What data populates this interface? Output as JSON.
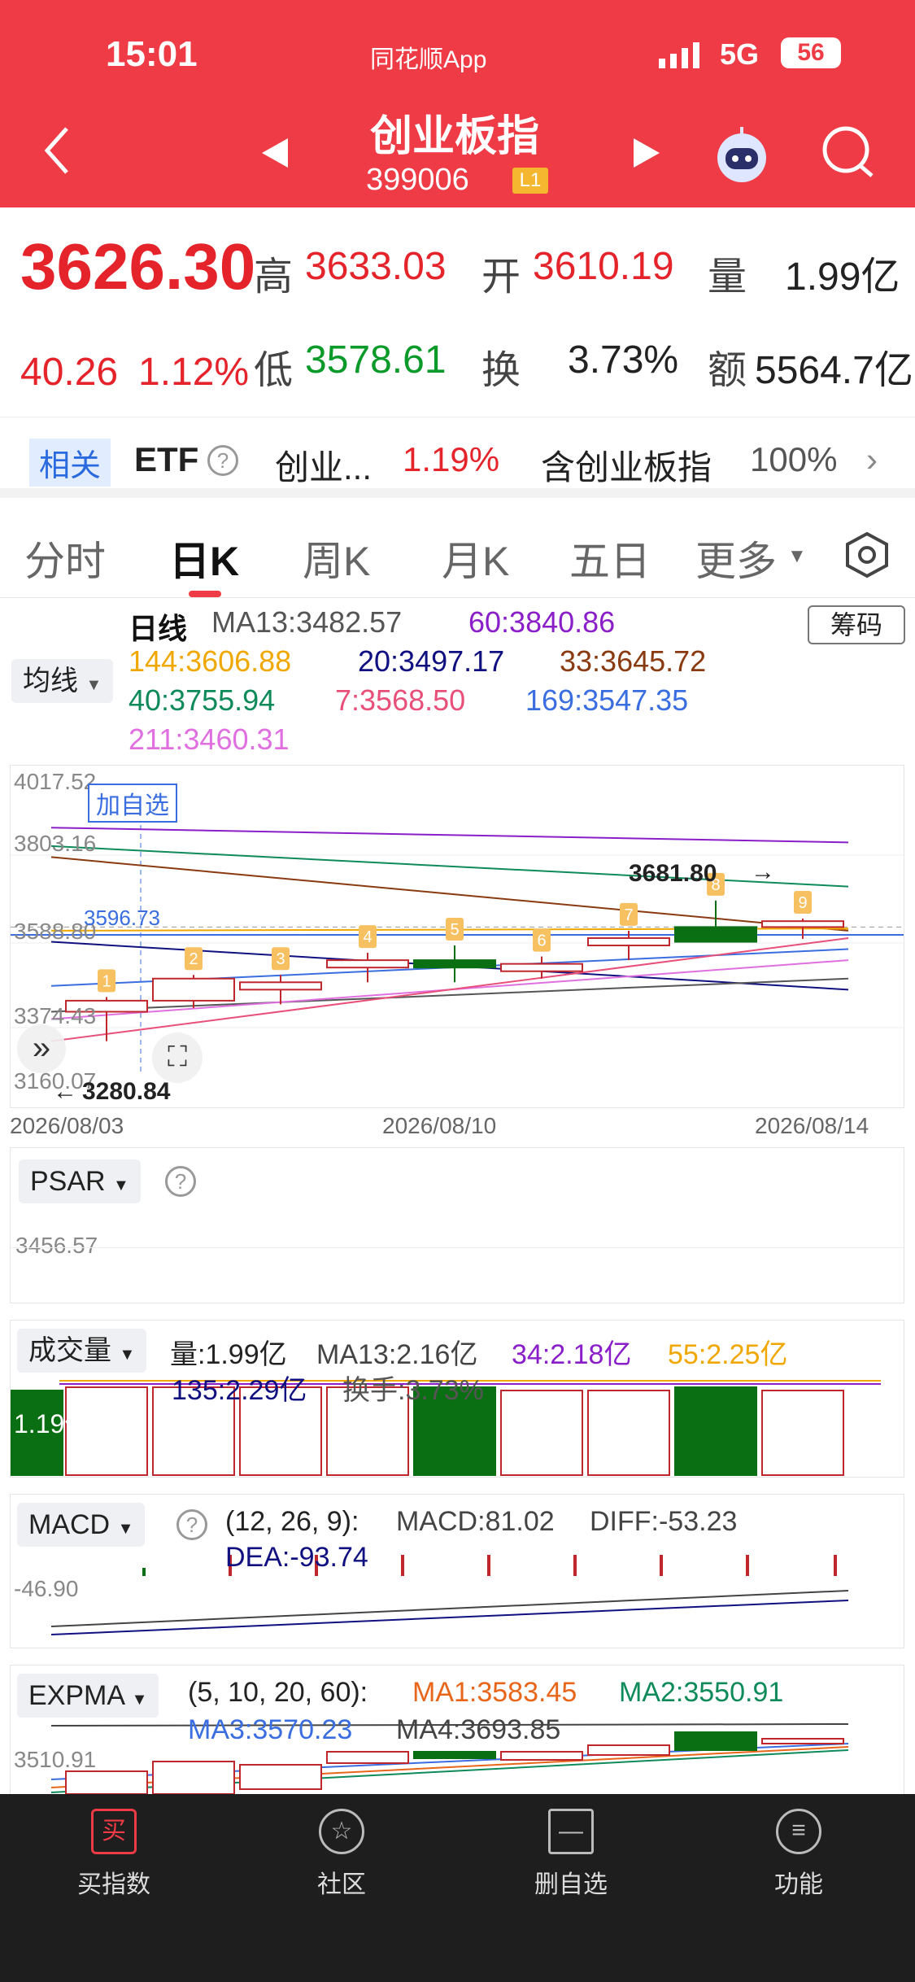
{
  "status_bar": {
    "time": "15:01",
    "app": "同花顺App",
    "network": "5G",
    "battery": "56"
  },
  "header": {
    "title": "创业板指",
    "code": "399006",
    "level": "L1"
  },
  "quote": {
    "price": "3626.30",
    "change": "40.26",
    "change_pct": "1.12%",
    "high_label": "高",
    "high": "3633.03",
    "open_label": "开",
    "open": "3610.19",
    "vol_label": "量",
    "vol": "1.99亿",
    "low_label": "低",
    "low": "3578.61",
    "turn_label": "换",
    "turn": "3.73%",
    "amt_label": "额",
    "amt": "5564.7亿"
  },
  "related": {
    "tag": "相关",
    "etf": "ETF",
    "name": "创业...",
    "pct": "1.19%",
    "contains": "含创业板指",
    "weight": "100%"
  },
  "tabs": [
    "分时",
    "日K",
    "周K",
    "月K",
    "五日",
    "更多"
  ],
  "kline": {
    "mode": "日线",
    "ma_button": "均线",
    "chip_button": "筹码",
    "add_watch": "加自选",
    "mas": [
      {
        "t": "MA13:3482.57",
        "c": "#555555"
      },
      {
        "t": "60:3840.86",
        "c": "#8a1ec8"
      },
      {
        "t": "144:3606.88",
        "c": "#f0a800"
      },
      {
        "t": "20:3497.17",
        "c": "#101080"
      },
      {
        "t": "33:3645.72",
        "c": "#8a3a10"
      },
      {
        "t": "40:3755.94",
        "c": "#0f8a5a"
      },
      {
        "t": "7:3568.50",
        "c": "#e8507a"
      },
      {
        "t": "169:3547.35",
        "c": "#3a6ee0"
      },
      {
        "t": "211:3460.31",
        "c": "#e070e0"
      }
    ],
    "y_ticks": [
      "4017.52",
      "3803.16",
      "3588.80",
      "3374.43",
      "3160.07"
    ],
    "crosshair_price": "3596.73",
    "high_mark": "3681.80",
    "low_mark": "3280.84",
    "dates": [
      "2026/08/03",
      "2026/08/10",
      "2026/08/14"
    ],
    "markers": [
      "1",
      "2",
      "3",
      "4",
      "5",
      "6",
      "7",
      "8",
      "9"
    ]
  },
  "chart_data": {
    "type": "candlestick",
    "candles": [
      {
        "o": 3380,
        "h": 3420,
        "l": 3300,
        "c": 3410,
        "up": true
      },
      {
        "o": 3410,
        "h": 3480,
        "l": 3390,
        "c": 3470,
        "up": true
      },
      {
        "o": 3440,
        "h": 3480,
        "l": 3400,
        "c": 3460,
        "up": true
      },
      {
        "o": 3500,
        "h": 3540,
        "l": 3460,
        "c": 3520,
        "up": true
      },
      {
        "o": 3520,
        "h": 3560,
        "l": 3460,
        "c": 3500,
        "up": false
      },
      {
        "o": 3490,
        "h": 3530,
        "l": 3470,
        "c": 3510,
        "up": true
      },
      {
        "o": 3560,
        "h": 3600,
        "l": 3520,
        "c": 3580,
        "up": true
      },
      {
        "o": 3610,
        "h": 3682,
        "l": 3580,
        "c": 3570,
        "up": false
      },
      {
        "o": 3610,
        "h": 3633,
        "l": 3578,
        "c": 3626,
        "up": true
      }
    ]
  },
  "psar": {
    "label": "PSAR",
    "value": "3456.57"
  },
  "volume": {
    "label": "成交量",
    "vol": "量:1.99亿",
    "ma13": "MA13:2.16亿",
    "ma34": "34:2.18亿",
    "ma55": "55:2.25亿",
    "ma135": "135:2.29亿",
    "turn": "换手:3.73%",
    "axis": "1.19亿"
  },
  "macd": {
    "label": "MACD",
    "params": "(12, 26, 9):",
    "macd": "MACD:81.02",
    "diff": "DIFF:-53.23",
    "dea": "DEA:-93.74",
    "axis": "-46.90"
  },
  "expma": {
    "label": "EXPMA",
    "params": "(5, 10, 20, 60):",
    "ma1": "MA1:3583.45",
    "ma2": "MA2:3550.91",
    "ma3": "MA3:3570.23",
    "ma4": "MA4:3693.85",
    "axis": "3510.91"
  },
  "nav": [
    {
      "label": "买指数",
      "icon": "buy"
    },
    {
      "label": "社区",
      "icon": "community"
    },
    {
      "label": "删自选",
      "icon": "remove"
    },
    {
      "label": "功能",
      "icon": "menu"
    }
  ]
}
